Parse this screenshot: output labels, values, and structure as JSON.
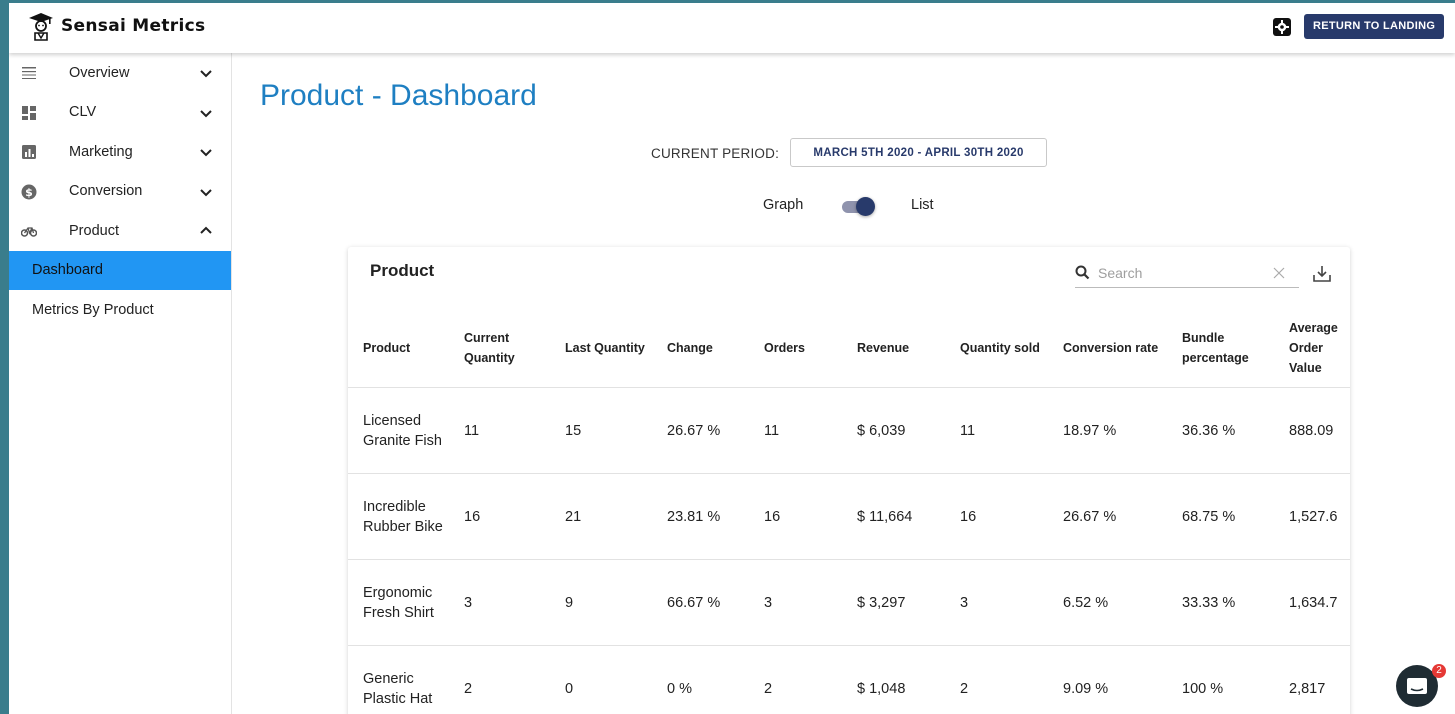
{
  "app": {
    "brand_name": "Sensai Metrics",
    "return_label": "RETURN TO LANDING",
    "accent": "#283a6b"
  },
  "sidebar": {
    "items": [
      {
        "label": "Overview",
        "icon": "overview-icon",
        "expanded": false
      },
      {
        "label": "CLV",
        "icon": "dashboard-grid-icon",
        "expanded": false
      },
      {
        "label": "Marketing",
        "icon": "bar-chart-icon",
        "expanded": false
      },
      {
        "label": "Conversion",
        "icon": "dollar-circle-icon",
        "expanded": false
      },
      {
        "label": "Product",
        "icon": "bike-icon",
        "expanded": true
      }
    ],
    "sub_items": [
      {
        "label": "Dashboard",
        "active": true
      },
      {
        "label": "Metrics By Product",
        "active": false
      }
    ]
  },
  "main": {
    "title": "Product - Dashboard",
    "period_label": "CURRENT PERIOD:",
    "period_value": "MARCH 5TH 2020 - APRIL 30TH 2020",
    "view_toggle": {
      "left_label": "Graph",
      "right_label": "List",
      "selected": "List"
    }
  },
  "table": {
    "title": "Product",
    "search_placeholder": "Search",
    "columns": [
      "Product",
      "Current Quantity",
      "Last Quantity",
      "Change",
      "Orders",
      "Revenue",
      "Quantity sold",
      "Conversion rate",
      "Bundle percentage",
      "Average Order Value"
    ],
    "rows": [
      {
        "product": "Licensed Granite Fish",
        "current_quantity": "11",
        "last_quantity": "15",
        "change": "26.67 %",
        "change_negative": true,
        "orders": "11",
        "revenue": "$ 6,039",
        "quantity_sold": "11",
        "conversion_rate": "18.97 %",
        "bundle_percentage": "36.36 %",
        "aov": "888.09"
      },
      {
        "product": "Incredible Rubber Bike",
        "current_quantity": "16",
        "last_quantity": "21",
        "change": "23.81 %",
        "change_negative": true,
        "orders": "16",
        "revenue": "$ 11,664",
        "quantity_sold": "16",
        "conversion_rate": "26.67 %",
        "bundle_percentage": "68.75 %",
        "aov": "1,527.6"
      },
      {
        "product": "Ergonomic Fresh Shirt",
        "current_quantity": "3",
        "last_quantity": "9",
        "change": "66.67 %",
        "change_negative": true,
        "orders": "3",
        "revenue": "$ 3,297",
        "quantity_sold": "3",
        "conversion_rate": "6.52 %",
        "bundle_percentage": "33.33 %",
        "aov": "1,634.7"
      },
      {
        "product": "Generic Plastic Hat",
        "current_quantity": "2",
        "last_quantity": "0",
        "change": "0 %",
        "change_negative": false,
        "orders": "2",
        "revenue": "$ 1,048",
        "quantity_sold": "2",
        "conversion_rate": "9.09 %",
        "bundle_percentage": "100 %",
        "aov": "2,817"
      }
    ]
  },
  "chat": {
    "badge": "2"
  }
}
